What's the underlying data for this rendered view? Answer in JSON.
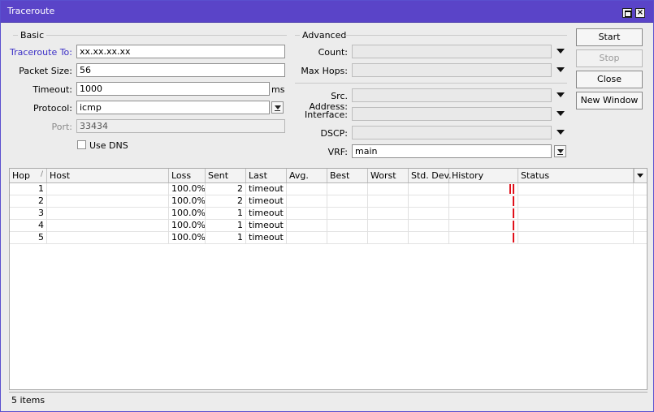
{
  "window": {
    "title": "Traceroute"
  },
  "basic": {
    "legend": "Basic",
    "traceroute_to": {
      "label": "Traceroute To:",
      "value": "xx.xx.xx.xx"
    },
    "packet_size": {
      "label": "Packet Size:",
      "value": "56"
    },
    "timeout": {
      "label": "Timeout:",
      "value": "1000",
      "unit": "ms"
    },
    "protocol": {
      "label": "Protocol:",
      "value": "icmp"
    },
    "port": {
      "label": "Port:",
      "value": "33434"
    },
    "use_dns": {
      "label": "Use DNS",
      "checked": false
    }
  },
  "advanced": {
    "legend": "Advanced",
    "count": {
      "label": "Count:",
      "value": ""
    },
    "max_hops": {
      "label": "Max Hops:",
      "value": ""
    },
    "src_address": {
      "label": "Src. Address:",
      "value": ""
    },
    "interface": {
      "label": "Interface:",
      "value": ""
    },
    "dscp": {
      "label": "DSCP:",
      "value": ""
    },
    "vrf": {
      "label": "VRF:",
      "value": "main"
    }
  },
  "buttons": {
    "start": "Start",
    "stop": "Stop",
    "close": "Close",
    "new_window": "New Window"
  },
  "table": {
    "columns": [
      "Hop",
      "Host",
      "Loss",
      "Sent",
      "Last",
      "Avg.",
      "Best",
      "Worst",
      "Std. Dev.",
      "History",
      "Status"
    ],
    "sort_indicator": "/",
    "rows": [
      {
        "hop": "1",
        "host": "",
        "loss": "100.0%",
        "sent": "2",
        "last": "timeout",
        "avg": "",
        "best": "",
        "worst": "",
        "std_dev": "",
        "history": 2,
        "status": ""
      },
      {
        "hop": "2",
        "host": "",
        "loss": "100.0%",
        "sent": "2",
        "last": "timeout",
        "avg": "",
        "best": "",
        "worst": "",
        "std_dev": "",
        "history": 1,
        "status": ""
      },
      {
        "hop": "3",
        "host": "",
        "loss": "100.0%",
        "sent": "1",
        "last": "timeout",
        "avg": "",
        "best": "",
        "worst": "",
        "std_dev": "",
        "history": 1,
        "status": ""
      },
      {
        "hop": "4",
        "host": "",
        "loss": "100.0%",
        "sent": "1",
        "last": "timeout",
        "avg": "",
        "best": "",
        "worst": "",
        "std_dev": "",
        "history": 1,
        "status": ""
      },
      {
        "hop": "5",
        "host": "",
        "loss": "100.0%",
        "sent": "1",
        "last": "timeout",
        "avg": "",
        "best": "",
        "worst": "",
        "std_dev": "",
        "history": 1,
        "status": ""
      }
    ]
  },
  "status_bar": {
    "items_text": "5 items"
  },
  "colors": {
    "titlebar": "#5a44c8",
    "link_label": "#3a2ec6",
    "history_timeout": "#e0101a"
  },
  "icons": {
    "maximize": "maximize-icon",
    "close": "close-icon",
    "dropdown": "chevron-down-icon"
  }
}
